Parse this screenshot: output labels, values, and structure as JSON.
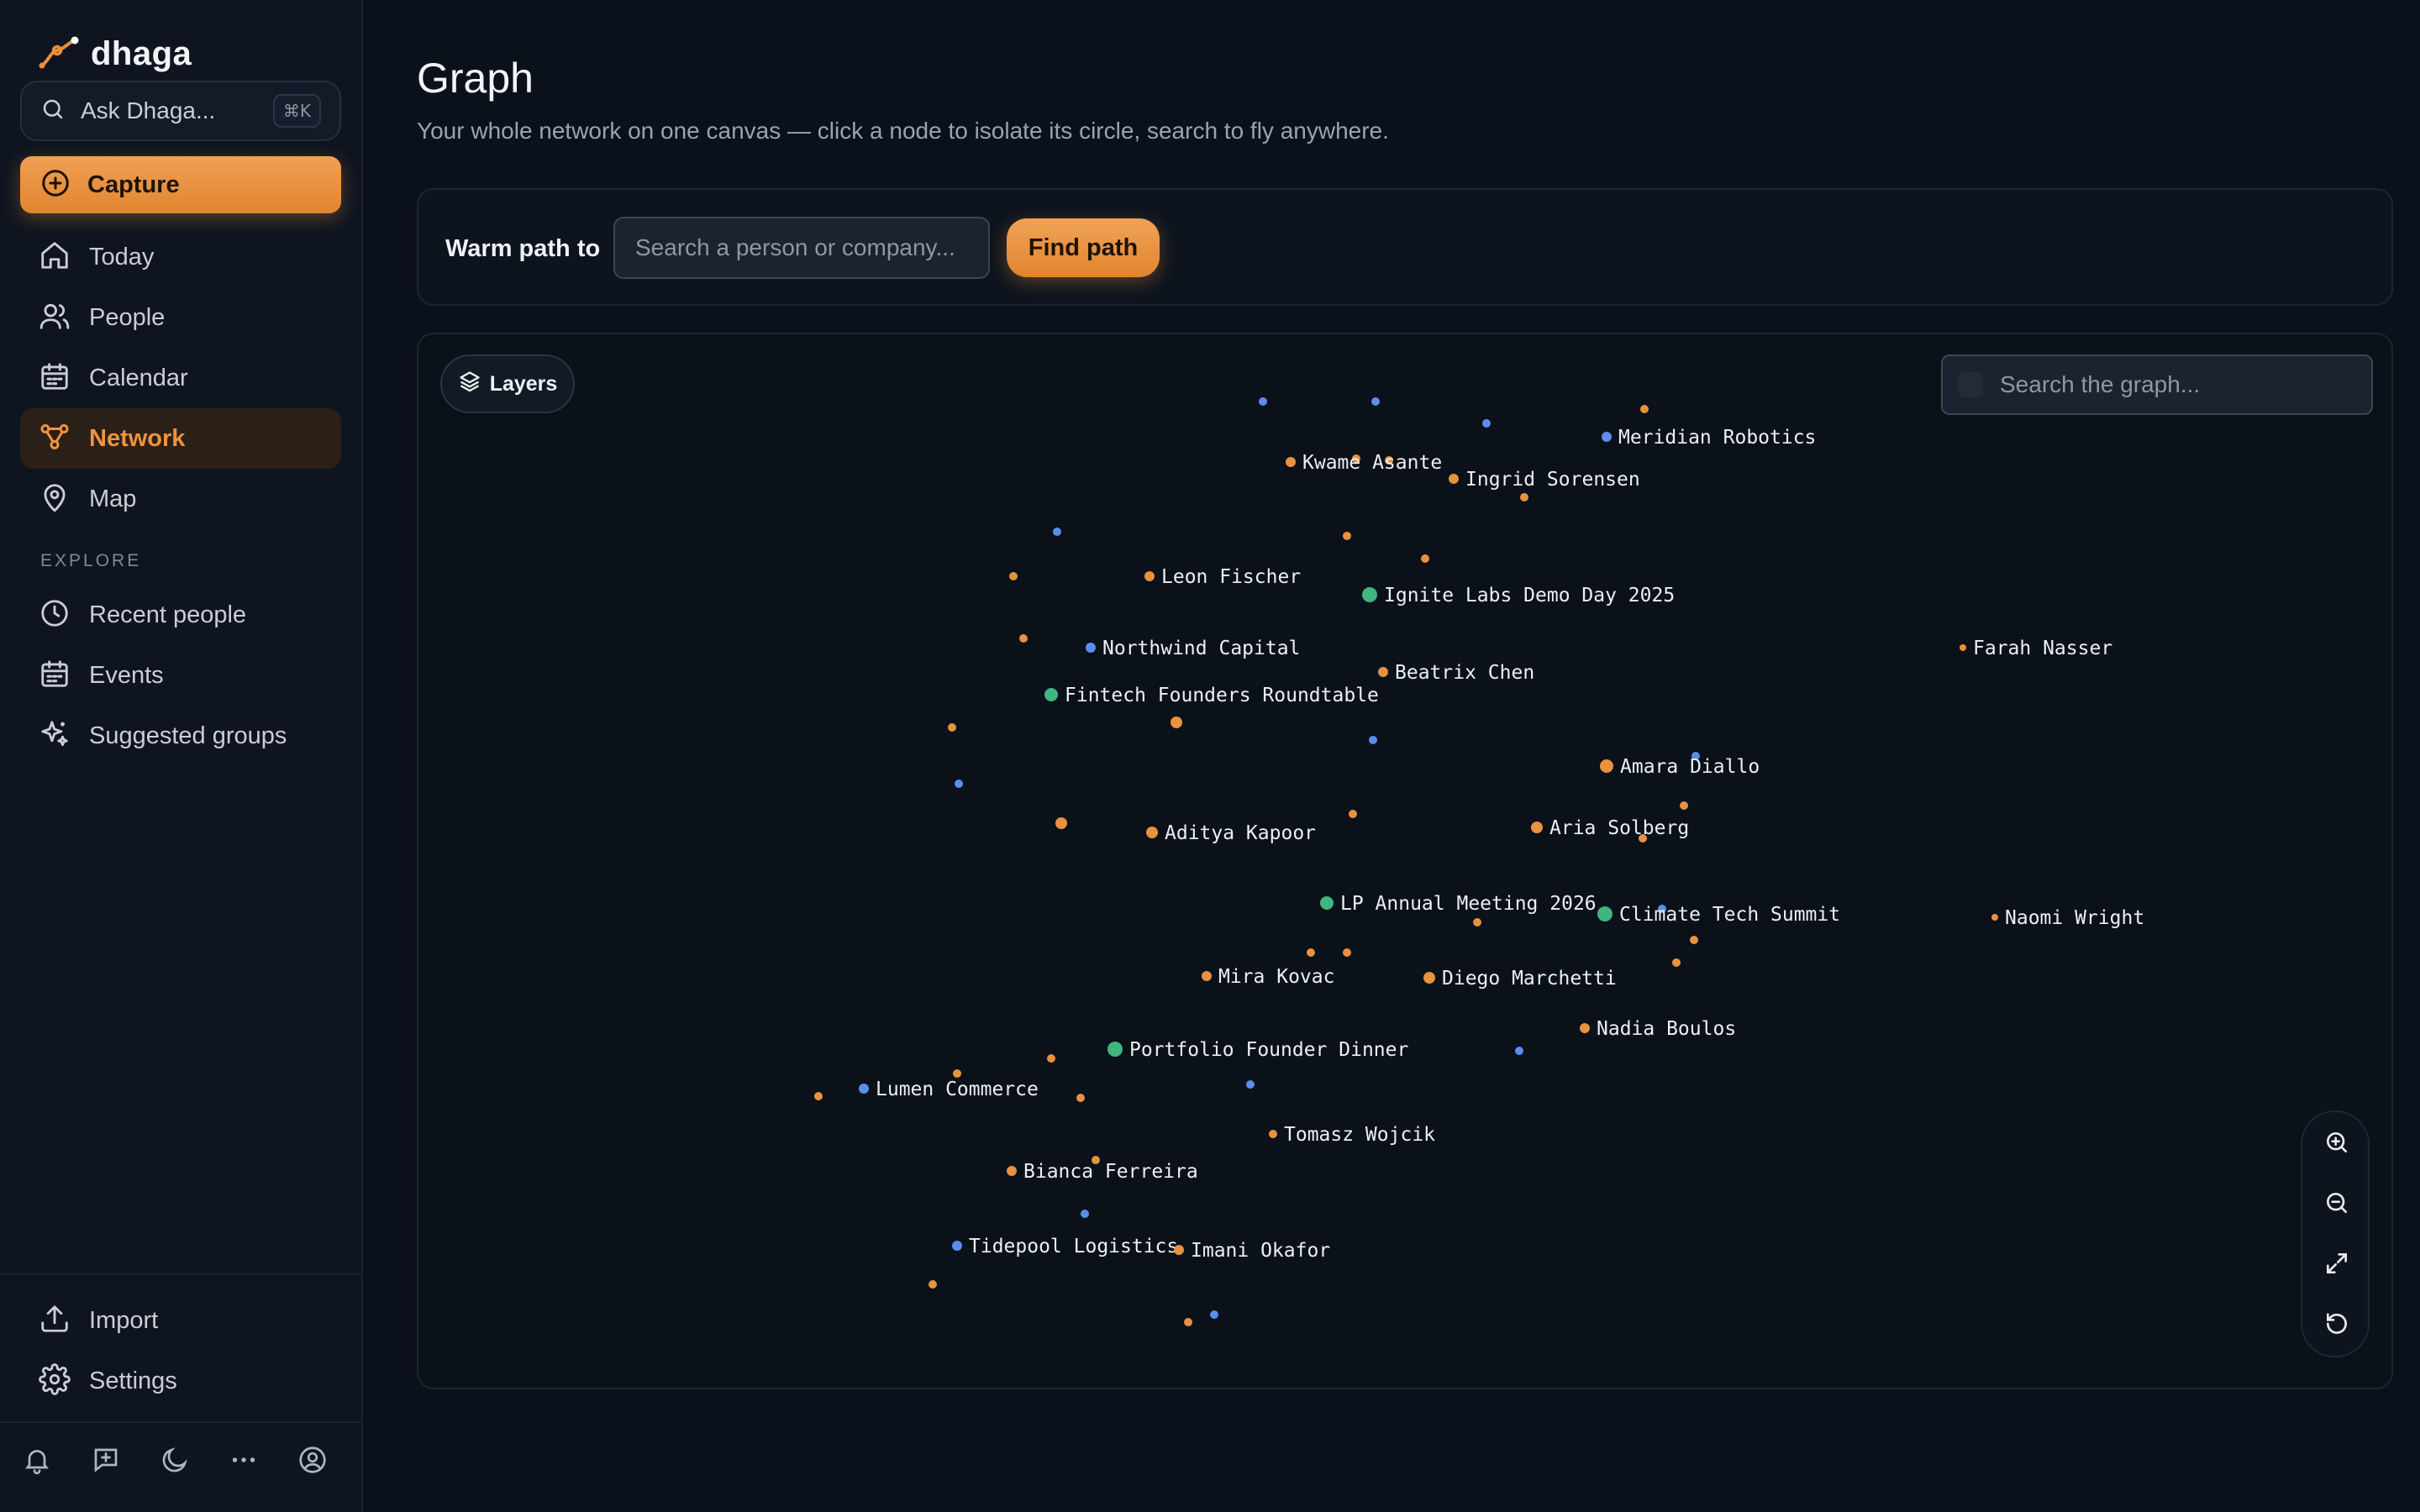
{
  "sidebar": {
    "brand": "dhaga",
    "ask_placeholder": "Ask Dhaga...",
    "ask_shortcut": "⌘K",
    "capture_label": "Capture",
    "nav": [
      {
        "label": "Today",
        "icon": "home-icon"
      },
      {
        "label": "People",
        "icon": "people-icon"
      },
      {
        "label": "Calendar",
        "icon": "calendar-icon"
      },
      {
        "label": "Network",
        "icon": "network-icon",
        "active": true
      },
      {
        "label": "Map",
        "icon": "map-pin-icon"
      }
    ],
    "explore_label": "EXPLORE",
    "explore": [
      {
        "label": "Recent people",
        "icon": "clock-icon"
      },
      {
        "label": "Events",
        "icon": "calendar-icon"
      },
      {
        "label": "Suggested groups",
        "icon": "sparkles-icon"
      }
    ],
    "bottom": [
      {
        "label": "Import",
        "icon": "upload-icon"
      },
      {
        "label": "Settings",
        "icon": "gear-icon"
      }
    ],
    "footer_icons": [
      "bell-icon",
      "message-plus-icon",
      "moon-icon",
      "more-icon",
      "user-circle-icon"
    ]
  },
  "header": {
    "title": "Graph",
    "subtitle": "Your whole network on one canvas — click a node to isolate its circle, search to fly anywhere."
  },
  "warm_path": {
    "label": "Warm path to",
    "input_placeholder": "Search a person or company...",
    "button_label": "Find path"
  },
  "graph": {
    "layers_label": "Layers",
    "search_placeholder": "Search the graph...",
    "colors": {
      "person": "#e8913f",
      "company": "#5b8def",
      "event": "#3fb57f",
      "background": "#0b1119"
    },
    "labeled_nodes": [
      {
        "label": "Meridian Robotics",
        "type": "company"
      },
      {
        "label": "Kwame Asante",
        "type": "person"
      },
      {
        "label": "Ingrid Sorensen",
        "type": "person"
      },
      {
        "label": "Leon Fischer",
        "type": "person"
      },
      {
        "label": "Ignite Labs Demo Day 2025",
        "type": "event"
      },
      {
        "label": "Farah Nasser",
        "type": "person"
      },
      {
        "label": "Northwind Capital",
        "type": "company"
      },
      {
        "label": "Beatrix Chen",
        "type": "person"
      },
      {
        "label": "Fintech Founders Roundtable",
        "type": "event"
      },
      {
        "label": "Amara Diallo",
        "type": "person"
      },
      {
        "label": "Aditya Kapoor",
        "type": "person"
      },
      {
        "label": "Aria Solberg",
        "type": "person"
      },
      {
        "label": "LP Annual Meeting 2026",
        "type": "event"
      },
      {
        "label": "Climate Tech Summit",
        "type": "event"
      },
      {
        "label": "Naomi Wright",
        "type": "person"
      },
      {
        "label": "Mira Kovac",
        "type": "person"
      },
      {
        "label": "Diego Marchetti",
        "type": "person"
      },
      {
        "label": "Nadia Boulos",
        "type": "person"
      },
      {
        "label": "Portfolio Founder Dinner",
        "type": "event"
      },
      {
        "label": "Lumen Commerce",
        "type": "company"
      },
      {
        "label": "Tomasz Wojcik",
        "type": "person"
      },
      {
        "label": "Bianca Ferreira",
        "type": "person"
      },
      {
        "label": "Tidepool Logistics",
        "type": "company"
      },
      {
        "label": "Imani Okafor",
        "type": "person"
      }
    ],
    "zoom_controls": [
      "zoom-in-icon",
      "zoom-out-icon",
      "expand-icon",
      "reset-icon"
    ]
  }
}
